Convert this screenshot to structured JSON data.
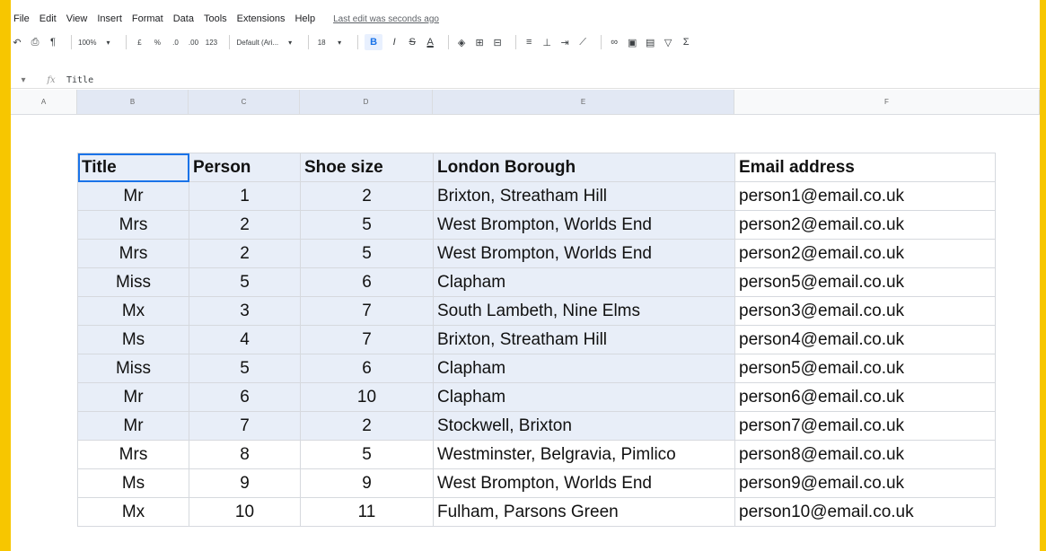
{
  "menu": {
    "items": [
      "File",
      "Edit",
      "View",
      "Insert",
      "Format",
      "Data",
      "Tools",
      "Extensions",
      "Help"
    ],
    "last_edit": "Last edit was seconds ago"
  },
  "toolbar": {
    "zoom": "100%",
    "currency": "£",
    "percent": "%",
    "dec_decrease": ".0",
    "dec_increase": ".00",
    "more_formats": "123",
    "font": "Default (Ari...",
    "font_size": "18",
    "bold": "B",
    "italic": "I",
    "strike": "S",
    "text_color": "A",
    "sum": "Σ"
  },
  "formula_bar": {
    "fx": "fx",
    "content": "Title"
  },
  "columns": [
    "A",
    "B",
    "C",
    "D",
    "E",
    "F"
  ],
  "table": {
    "headers": [
      "Title",
      "Person",
      "Shoe size",
      "London Borough",
      "Email address"
    ],
    "rows": [
      [
        "Mr",
        "1",
        "2",
        "Brixton, Streatham Hill",
        "person1@email.co.uk"
      ],
      [
        "Mrs",
        "2",
        "5",
        "West Brompton, Worlds End",
        "person2@email.co.uk"
      ],
      [
        "Mrs",
        "2",
        "5",
        "West Brompton, Worlds End",
        "person2@email.co.uk"
      ],
      [
        "Miss",
        "5",
        "6",
        "Clapham",
        "person5@email.co.uk"
      ],
      [
        "Mx",
        "3",
        "7",
        "South Lambeth, Nine Elms",
        "person3@email.co.uk"
      ],
      [
        "Ms",
        "4",
        "7",
        "Brixton, Streatham Hill",
        "person4@email.co.uk"
      ],
      [
        "Miss",
        "5",
        "6",
        "Clapham",
        "person5@email.co.uk"
      ],
      [
        "Mr",
        "6",
        "10",
        "Clapham",
        "person6@email.co.uk"
      ],
      [
        "Mr",
        "7",
        "2",
        "Stockwell, Brixton",
        "person7@email.co.uk"
      ],
      [
        "Mrs",
        "8",
        "5",
        "Westminster, Belgravia, Pimlico",
        "person8@email.co.uk"
      ],
      [
        "Ms",
        "9",
        "9",
        "West Brompton, Worlds End",
        "person9@email.co.uk"
      ],
      [
        "Mx",
        "10",
        "11",
        "Fulham, Parsons Green",
        "person10@email.co.uk"
      ]
    ]
  },
  "colors": {
    "frame": "#f7c600",
    "selection": "#e8eef8",
    "active_border": "#1a73e8"
  }
}
